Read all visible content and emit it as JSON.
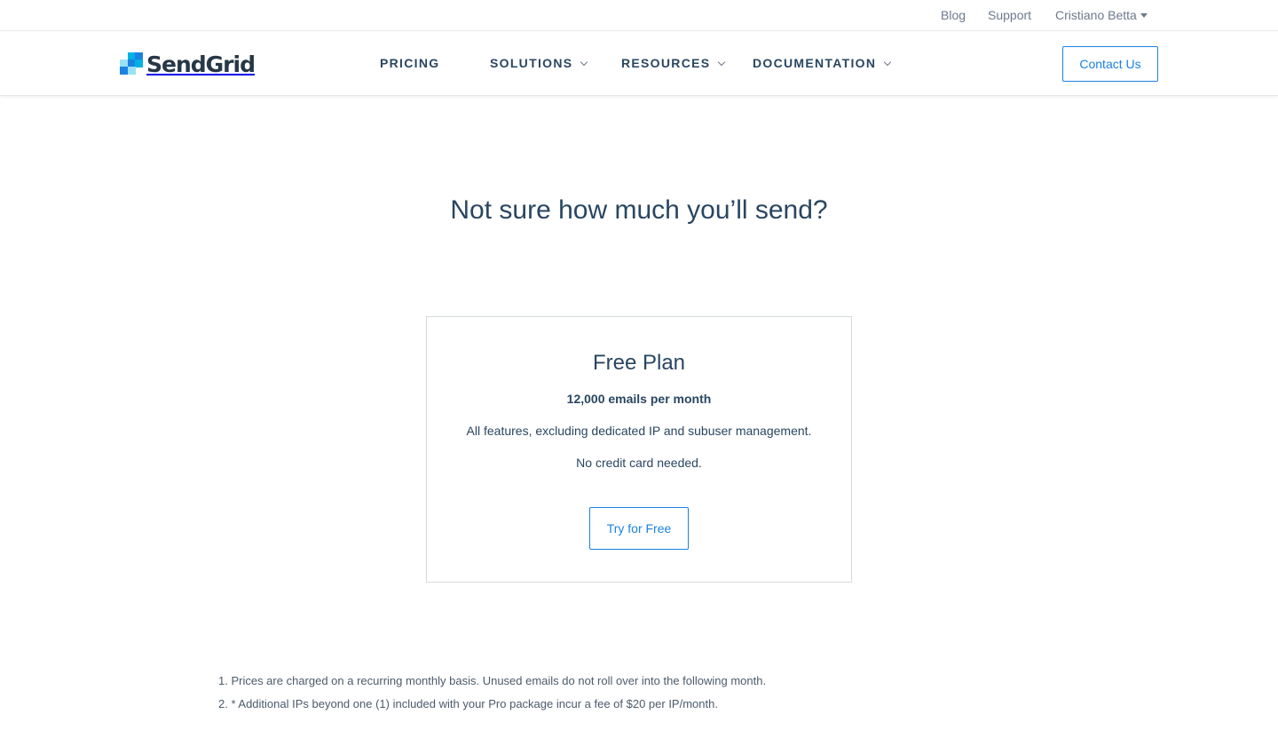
{
  "topbar": {
    "links": {
      "blog": "Blog",
      "support": "Support",
      "user": "Cristiano Betta"
    }
  },
  "header": {
    "logo_text": "SendGrid",
    "nav": {
      "pricing": "PRICING",
      "solutions": "SOLUTIONS",
      "resources": "RESOURCES",
      "documentation": "DOCUMENTATION"
    },
    "contact_label": "Contact Us"
  },
  "main": {
    "headline": "Not sure how much you’ll send?",
    "plan": {
      "title": "Free Plan",
      "emails": "12,000 emails per month",
      "features": "All features, excluding dedicated IP and subuser management.",
      "note": "No credit card needed.",
      "cta_label": "Try for Free"
    },
    "footnotes": [
      "1. Prices are charged on a recurring monthly basis. Unused emails do not roll over into the following month.",
      "2. * Additional IPs beyond one (1) included with your Pro package incur a fee of $20 per IP/month."
    ]
  },
  "colors": {
    "brand_blue": "#1a82e2",
    "text_dark": "#294661",
    "logo_light_blue": "#99e1f4",
    "logo_mid_blue": "#00b2e3",
    "logo_dark_blue": "#1a82e2"
  },
  "icons": {
    "user_menu": "caret-down-icon",
    "nav_dropdown": "chevron-down-icon"
  }
}
